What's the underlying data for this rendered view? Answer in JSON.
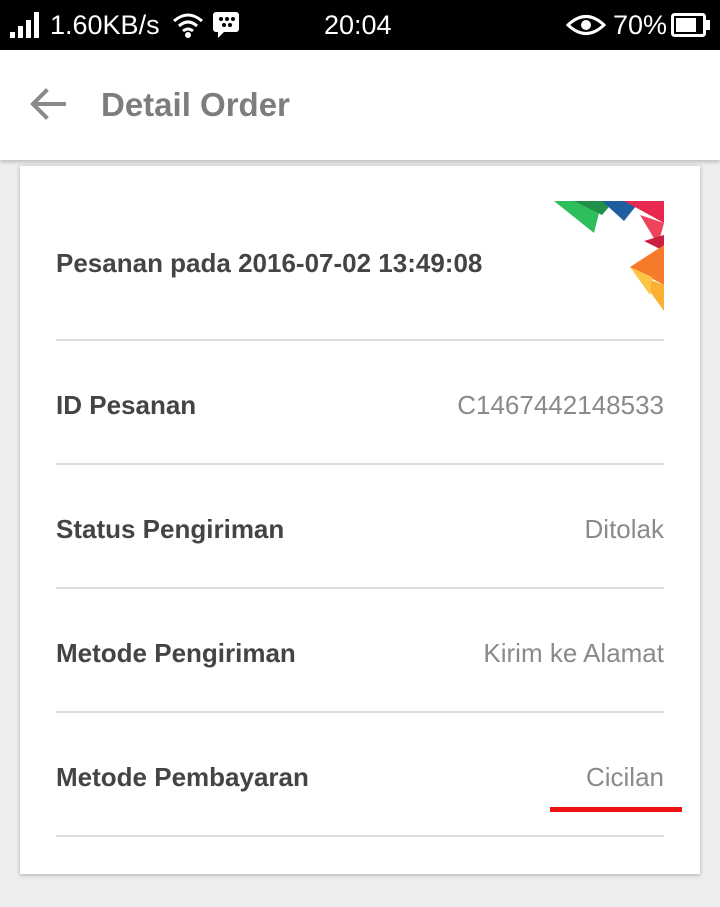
{
  "status_bar": {
    "speed": "1.60KB/s",
    "time": "20:04",
    "battery": "70%",
    "icons": [
      "signal-icon",
      "wifi-icon",
      "bbm-icon",
      "eye-icon",
      "battery-icon"
    ]
  },
  "app_bar": {
    "title": "Detail Order",
    "back_icon": "back-arrow-icon"
  },
  "order": {
    "heading": "Pesanan pada 2016-07-02 13:49:08",
    "rows": [
      {
        "label": "ID Pesanan",
        "value": "C1467442148533"
      },
      {
        "label": "Status Pengiriman",
        "value": "Ditolak"
      },
      {
        "label": "Metode Pengiriman",
        "value": "Kirim ke Alamat"
      },
      {
        "label": "Metode Pembayaran",
        "value": "Cicilan"
      }
    ]
  },
  "colors": {
    "accent_red": "#ee1111",
    "title_gray": "#7d7d7d",
    "label_dark": "#444444",
    "value_gray": "#8a8a8a"
  }
}
